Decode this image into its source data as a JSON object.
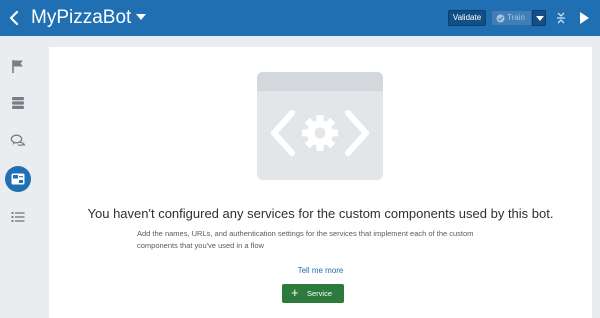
{
  "header": {
    "title": "MyPizzaBot",
    "validate_label": "Validate",
    "train_label": "Train"
  },
  "sidebar": {
    "items": [
      {
        "icon": "flag-icon"
      },
      {
        "icon": "database-icon"
      },
      {
        "icon": "chat-bubbles-icon"
      },
      {
        "icon": "components-icon",
        "active": true
      },
      {
        "icon": "list-icon"
      }
    ]
  },
  "main": {
    "message": "You haven't configured any services for the custom components used by this bot.",
    "subtext": "Add the names, URLs, and authentication settings for the services that implement each of the custom components that you've used in a flow",
    "tell_me_more": "Tell me more",
    "add_service_label": "Service"
  },
  "colors": {
    "header": "#1f6fb2",
    "accent_green": "#2c7b3c",
    "background": "#e9edf0"
  }
}
